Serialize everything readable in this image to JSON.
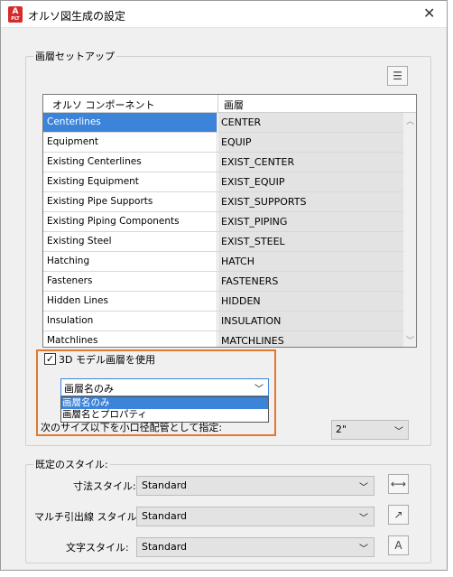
{
  "window": {
    "title": "オルソ図生成の設定",
    "app_icon_letter": "A"
  },
  "layer_setup": {
    "group_label": "画層セットアップ",
    "columns": [
      "オルソ コンポーネント",
      "画層"
    ],
    "rows": [
      {
        "component": "Centerlines",
        "layer": "CENTER"
      },
      {
        "component": "Equipment",
        "layer": "EQUIP"
      },
      {
        "component": "Existing Centerlines",
        "layer": "EXIST_CENTER"
      },
      {
        "component": "Existing Equipment",
        "layer": "EXIST_EQUIP"
      },
      {
        "component": "Existing Pipe Supports",
        "layer": "EXIST_SUPPORTS"
      },
      {
        "component": "Existing Piping Components",
        "layer": "EXIST_PIPING"
      },
      {
        "component": "Existing Steel",
        "layer": "EXIST_STEEL"
      },
      {
        "component": "Hatching",
        "layer": "HATCH"
      },
      {
        "component": "Fasteners",
        "layer": "FASTENERS"
      },
      {
        "component": "Hidden Lines",
        "layer": "HIDDEN"
      },
      {
        "component": "Insulation",
        "layer": "INSULATION"
      },
      {
        "component": "Matchlines",
        "layer": "MATCHLINES"
      }
    ],
    "selected_row": 0,
    "use_3d_layer": {
      "label": "3D モデル画層を使用",
      "checked": true
    },
    "layer_mode": {
      "value": "画層名のみ",
      "options": [
        "画層名のみ",
        "画層名とプロパティ"
      ],
      "highlighted": 0
    },
    "small_pipe_label": "次のサイズ以下を小口径配管として指定:",
    "small_pipe_value": "2\""
  },
  "default_styles": {
    "group_label": "既定のスタイル:",
    "dimension": {
      "label": "寸法スタイル:",
      "value": "Standard"
    },
    "mleader": {
      "label": "マルチ引出線 スタイル:",
      "value": "Standard"
    },
    "text": {
      "label": "文字スタイル:",
      "value": "Standard"
    }
  },
  "colors": {
    "selection": "#3b84d9",
    "highlight_box": "#e07a2e",
    "app_icon": "#d52b2b"
  }
}
